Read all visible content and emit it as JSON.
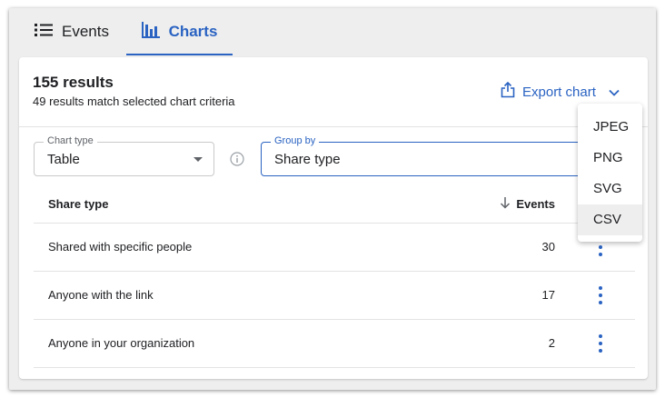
{
  "tabs": [
    {
      "label": "Events",
      "icon": "list-icon",
      "active": false
    },
    {
      "label": "Charts",
      "icon": "bar-chart-icon",
      "active": true
    }
  ],
  "summary": {
    "title": "155 results",
    "subtitle": "49 results match selected chart criteria"
  },
  "export": {
    "label": "Export chart",
    "icon": "share-export-icon",
    "options": [
      "JPEG",
      "PNG",
      "SVG",
      "CSV"
    ],
    "hovered": "CSV"
  },
  "controls": {
    "chart_type": {
      "label": "Chart type",
      "value": "Table"
    },
    "group_by": {
      "label": "Group by",
      "value": "Share type"
    }
  },
  "table": {
    "columns": [
      "Share type",
      "Events"
    ],
    "sort": "descending",
    "rows": [
      {
        "name": "Shared with specific people",
        "events": "30"
      },
      {
        "name": "Anyone with the link",
        "events": "17"
      },
      {
        "name": "Anyone in your organization",
        "events": "2"
      }
    ]
  },
  "colors": {
    "accent": "#2a63c2",
    "frame": "#eeeeee",
    "divider": "#e3e3e3"
  }
}
